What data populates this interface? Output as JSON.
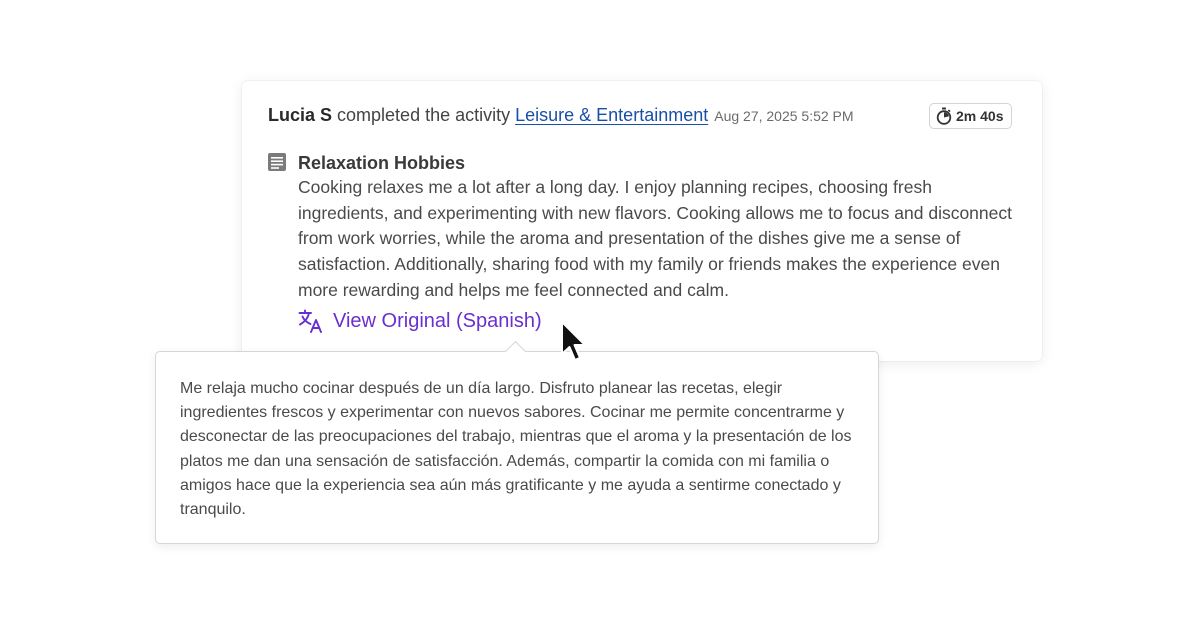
{
  "activity": {
    "user_name": "Lucia S",
    "action_text": " completed the activity ",
    "activity_name": "Leisure & Entertainment",
    "timestamp": "Aug 27, 2025 5:52 PM",
    "duration": "2m 40s",
    "duration_icon": "stopwatch-icon"
  },
  "entry": {
    "icon": "document-icon",
    "title": "Relaxation Hobbies",
    "body": "Cooking relaxes me a lot after a long day. I enjoy planning recipes, choosing fresh ingredients, and experimenting with new flavors. Cooking allows me to focus and disconnect from work worries, while the aroma and presentation of the dishes give me a sense of satisfaction. Additionally, sharing food with my family or friends makes the experience even more rewarding and helps me feel connected and calm.",
    "view_original_icon": "translate-icon",
    "view_original_label": "View Original (Spanish)"
  },
  "original_popover": {
    "text": "Me relaja mucho cocinar después de un día largo. Disfruto planear las recetas, elegir ingredientes frescos y experimentar con nuevos sabores. Cocinar me permite concentrarme y desconectar de las preocupaciones del trabajo, mientras que el aroma y la presentación de los platos me dan una sensación de satisfacción. Además, compartir la comida con mi familia o amigos hace que la experiencia sea aún más gratificante y me ayuda a sentirme conectado y tranquilo."
  },
  "colors": {
    "link": "#1a4fa8",
    "accent_purple": "#6a2fd0",
    "text": "#4a4a4a"
  }
}
